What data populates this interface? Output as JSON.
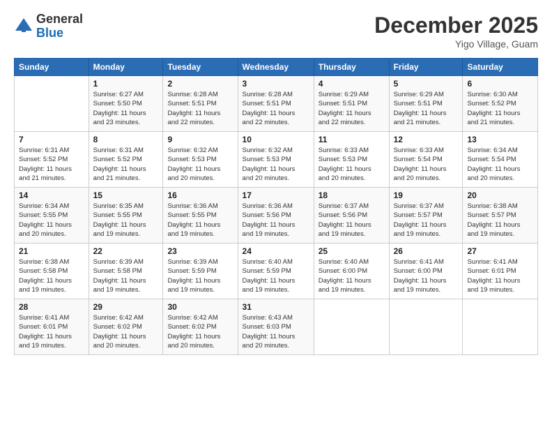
{
  "logo": {
    "general": "General",
    "blue": "Blue"
  },
  "title": "December 2025",
  "location": "Yigo Village, Guam",
  "days_header": [
    "Sunday",
    "Monday",
    "Tuesday",
    "Wednesday",
    "Thursday",
    "Friday",
    "Saturday"
  ],
  "weeks": [
    [
      {
        "num": "",
        "info": ""
      },
      {
        "num": "1",
        "info": "Sunrise: 6:27 AM\nSunset: 5:50 PM\nDaylight: 11 hours\nand 23 minutes."
      },
      {
        "num": "2",
        "info": "Sunrise: 6:28 AM\nSunset: 5:51 PM\nDaylight: 11 hours\nand 22 minutes."
      },
      {
        "num": "3",
        "info": "Sunrise: 6:28 AM\nSunset: 5:51 PM\nDaylight: 11 hours\nand 22 minutes."
      },
      {
        "num": "4",
        "info": "Sunrise: 6:29 AM\nSunset: 5:51 PM\nDaylight: 11 hours\nand 22 minutes."
      },
      {
        "num": "5",
        "info": "Sunrise: 6:29 AM\nSunset: 5:51 PM\nDaylight: 11 hours\nand 21 minutes."
      },
      {
        "num": "6",
        "info": "Sunrise: 6:30 AM\nSunset: 5:52 PM\nDaylight: 11 hours\nand 21 minutes."
      }
    ],
    [
      {
        "num": "7",
        "info": "Sunrise: 6:31 AM\nSunset: 5:52 PM\nDaylight: 11 hours\nand 21 minutes."
      },
      {
        "num": "8",
        "info": "Sunrise: 6:31 AM\nSunset: 5:52 PM\nDaylight: 11 hours\nand 21 minutes."
      },
      {
        "num": "9",
        "info": "Sunrise: 6:32 AM\nSunset: 5:53 PM\nDaylight: 11 hours\nand 20 minutes."
      },
      {
        "num": "10",
        "info": "Sunrise: 6:32 AM\nSunset: 5:53 PM\nDaylight: 11 hours\nand 20 minutes."
      },
      {
        "num": "11",
        "info": "Sunrise: 6:33 AM\nSunset: 5:53 PM\nDaylight: 11 hours\nand 20 minutes."
      },
      {
        "num": "12",
        "info": "Sunrise: 6:33 AM\nSunset: 5:54 PM\nDaylight: 11 hours\nand 20 minutes."
      },
      {
        "num": "13",
        "info": "Sunrise: 6:34 AM\nSunset: 5:54 PM\nDaylight: 11 hours\nand 20 minutes."
      }
    ],
    [
      {
        "num": "14",
        "info": "Sunrise: 6:34 AM\nSunset: 5:55 PM\nDaylight: 11 hours\nand 20 minutes."
      },
      {
        "num": "15",
        "info": "Sunrise: 6:35 AM\nSunset: 5:55 PM\nDaylight: 11 hours\nand 19 minutes."
      },
      {
        "num": "16",
        "info": "Sunrise: 6:36 AM\nSunset: 5:55 PM\nDaylight: 11 hours\nand 19 minutes."
      },
      {
        "num": "17",
        "info": "Sunrise: 6:36 AM\nSunset: 5:56 PM\nDaylight: 11 hours\nand 19 minutes."
      },
      {
        "num": "18",
        "info": "Sunrise: 6:37 AM\nSunset: 5:56 PM\nDaylight: 11 hours\nand 19 minutes."
      },
      {
        "num": "19",
        "info": "Sunrise: 6:37 AM\nSunset: 5:57 PM\nDaylight: 11 hours\nand 19 minutes."
      },
      {
        "num": "20",
        "info": "Sunrise: 6:38 AM\nSunset: 5:57 PM\nDaylight: 11 hours\nand 19 minutes."
      }
    ],
    [
      {
        "num": "21",
        "info": "Sunrise: 6:38 AM\nSunset: 5:58 PM\nDaylight: 11 hours\nand 19 minutes."
      },
      {
        "num": "22",
        "info": "Sunrise: 6:39 AM\nSunset: 5:58 PM\nDaylight: 11 hours\nand 19 minutes."
      },
      {
        "num": "23",
        "info": "Sunrise: 6:39 AM\nSunset: 5:59 PM\nDaylight: 11 hours\nand 19 minutes."
      },
      {
        "num": "24",
        "info": "Sunrise: 6:40 AM\nSunset: 5:59 PM\nDaylight: 11 hours\nand 19 minutes."
      },
      {
        "num": "25",
        "info": "Sunrise: 6:40 AM\nSunset: 6:00 PM\nDaylight: 11 hours\nand 19 minutes."
      },
      {
        "num": "26",
        "info": "Sunrise: 6:41 AM\nSunset: 6:00 PM\nDaylight: 11 hours\nand 19 minutes."
      },
      {
        "num": "27",
        "info": "Sunrise: 6:41 AM\nSunset: 6:01 PM\nDaylight: 11 hours\nand 19 minutes."
      }
    ],
    [
      {
        "num": "28",
        "info": "Sunrise: 6:41 AM\nSunset: 6:01 PM\nDaylight: 11 hours\nand 19 minutes."
      },
      {
        "num": "29",
        "info": "Sunrise: 6:42 AM\nSunset: 6:02 PM\nDaylight: 11 hours\nand 20 minutes."
      },
      {
        "num": "30",
        "info": "Sunrise: 6:42 AM\nSunset: 6:02 PM\nDaylight: 11 hours\nand 20 minutes."
      },
      {
        "num": "31",
        "info": "Sunrise: 6:43 AM\nSunset: 6:03 PM\nDaylight: 11 hours\nand 20 minutes."
      },
      {
        "num": "",
        "info": ""
      },
      {
        "num": "",
        "info": ""
      },
      {
        "num": "",
        "info": ""
      }
    ]
  ]
}
